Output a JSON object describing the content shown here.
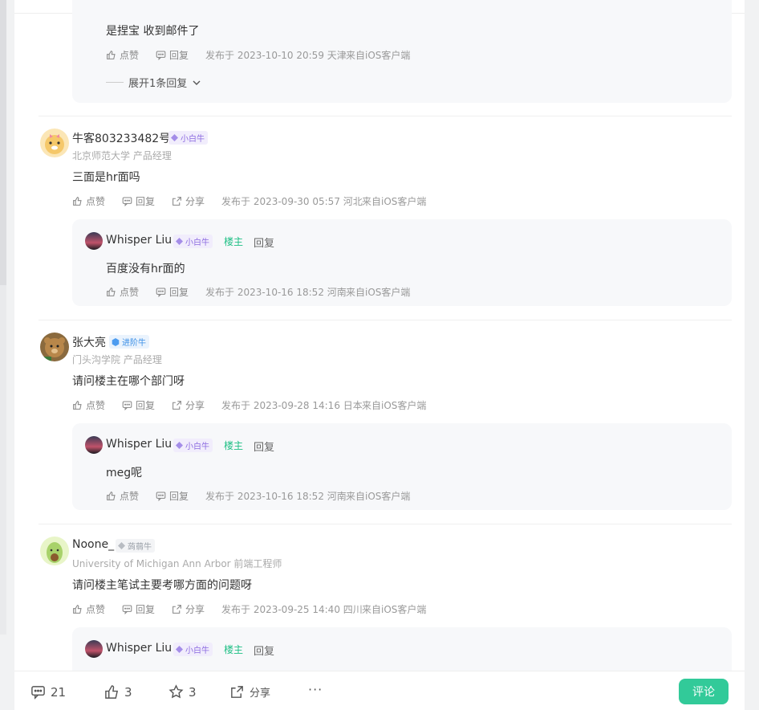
{
  "labels": {
    "like": "点赞",
    "reply": "回复",
    "share": "分享",
    "op": "楼主",
    "expand": "展开1条回复"
  },
  "top_reply": {
    "text": "是捏宝 收到邮件了",
    "meta": "发布于 2023-10-10 20:59 天津",
    "client": "来自iOS客户端"
  },
  "comments": [
    {
      "author": "牛客803233482号",
      "badge": "小白牛",
      "badge_color": "#8c6be0",
      "subtitle": "北京师范大学 产品经理",
      "text": "三面是hr面吗",
      "meta": "发布于 2023-09-30 05:57 河北",
      "client": "来自iOS客户端",
      "reply": {
        "author": "Whisper  Liu",
        "badge": "小白牛",
        "text": "百度没有hr面的",
        "meta": "发布于 2023-10-16 18:52 河南",
        "client": "来自iOS客户端"
      }
    },
    {
      "author": "张大亮",
      "badge": "进阶牛",
      "badge_color": "#3a8ee6",
      "subtitle": "门头沟学院 产品经理",
      "text": "请问楼主在哪个部门呀",
      "meta": "发布于 2023-09-28 14:16 日本",
      "client": "来自iOS客户端",
      "reply": {
        "author": "Whisper  Liu",
        "badge": "小白牛",
        "text": "meg呢",
        "meta": "发布于 2023-10-16 18:52 河南",
        "client": "来自iOS客户端"
      }
    },
    {
      "author": "Noone_",
      "badge": "蒟蒻牛",
      "badge_color": "#9aa0a8",
      "subtitle": "University of Michigan Ann Arbor 前端工程师",
      "text": "请问楼主笔试主要考哪方面的问题呀",
      "meta": "发布于 2023-09-25 14:40 四川",
      "client": "来自iOS客户端",
      "reply": {
        "author": "Whisper  Liu",
        "badge": "小白牛"
      }
    }
  ],
  "bottom": {
    "comments": "21",
    "likes": "3",
    "stars": "3",
    "share": "分享",
    "more": "···",
    "comment_button": "评论"
  },
  "colors": {
    "accent": "#32ca99",
    "op": "#1fbf85"
  }
}
